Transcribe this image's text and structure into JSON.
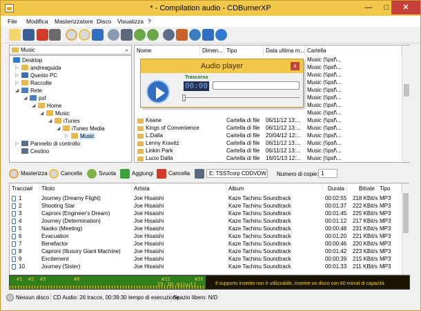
{
  "window": {
    "title": "* - Compilation audio - CDBurnerXP",
    "minimize": "—",
    "maximize": "□",
    "close": "✕"
  },
  "menu": [
    "File",
    "Modifica",
    "Masterizzatore",
    "Disco",
    "Visualizza",
    "?"
  ],
  "toolbar_icons": [
    "new-icon",
    "save-icon",
    "delete-icon",
    "print-icon",
    "burn-icon",
    "burn-disc-icon",
    "stop-icon",
    "disc-info-icon",
    "eject-icon",
    "back-icon",
    "forward-icon",
    "settings-icon",
    "tools-icon",
    "update-icon",
    "help-icon",
    "info-icon"
  ],
  "drive_selector": {
    "value": "Music"
  },
  "tree": [
    {
      "label": "Desktop",
      "icon": "desktop-icon"
    },
    {
      "label": "andreaguida",
      "icon": "folder-icon"
    },
    {
      "label": "Questo PC",
      "icon": "computer-icon"
    },
    {
      "label": "Raccolte",
      "icon": "folder-icon"
    },
    {
      "label": "Rete",
      "icon": "network-icon"
    },
    {
      "label": "psf",
      "icon": "network-icon"
    },
    {
      "label": "Home",
      "icon": "folder-icon"
    },
    {
      "label": "Music",
      "icon": "folder-icon"
    },
    {
      "label": "iTunes",
      "icon": "folder-icon"
    },
    {
      "label": "iTunes Media",
      "icon": "folder-icon"
    },
    {
      "label": "Music",
      "icon": "folder-icon"
    },
    {
      "label": "Pannello di controllo",
      "icon": "control-panel-icon"
    },
    {
      "label": "Cestino",
      "icon": "trash-icon"
    }
  ],
  "files": {
    "columns": [
      "Nome",
      "Dimen...",
      "Tipo",
      "Data ultima m...",
      "Cartella"
    ],
    "rows": [
      {
        "name": "",
        "type": "",
        "date": "",
        "folder": "Music (\\\\psf\\..."
      },
      {
        "name": "",
        "type": "",
        "date": "",
        "folder": "Music (\\\\psf\\..."
      },
      {
        "name": "",
        "type": "",
        "date": "",
        "folder": "Music (\\\\psf\\..."
      },
      {
        "name": "",
        "type": "",
        "date": "",
        "folder": "Music (\\\\psf\\..."
      },
      {
        "name": "",
        "type": "",
        "date": "",
        "folder": "Music (\\\\psf\\..."
      },
      {
        "name": "",
        "type": "",
        "date": "",
        "folder": "Music (\\\\psf\\..."
      },
      {
        "name": "",
        "type": "",
        "date": "",
        "folder": "Music (\\\\psf\\..."
      },
      {
        "name": "",
        "type": "",
        "date": "",
        "folder": "Music (\\\\psf\\..."
      },
      {
        "name": "Keane",
        "type": "Cartella di file",
        "date": "06/11/12 13:...",
        "folder": "Music (\\\\psf\\..."
      },
      {
        "name": "Kings of Convenience",
        "type": "Cartella di file",
        "date": "06/11/12 13:...",
        "folder": "Music (\\\\psf\\..."
      },
      {
        "name": "L.Dalla",
        "type": "Cartella di file",
        "date": "20/04/12 12:...",
        "folder": "Music (\\\\psf\\..."
      },
      {
        "name": "Lenny Kravitz",
        "type": "Cartella di file",
        "date": "06/11/12 13:...",
        "folder": "Music (\\\\psf\\..."
      },
      {
        "name": "Linkin Park",
        "type": "Cartella di file",
        "date": "06/11/12 13:...",
        "folder": "Music (\\\\psf\\..."
      },
      {
        "name": "Lucio Dalla",
        "type": "Cartella di file",
        "date": "16/01/13 12:...",
        "folder": "Music (\\\\psf\\..."
      }
    ]
  },
  "player": {
    "title": "Audio player",
    "elapsed_label": "Trascorso",
    "time": "00:00",
    "close": "x"
  },
  "actions": {
    "masterizza": "Masterizza",
    "cancella1": "Cancella",
    "svuota": "Svuota",
    "aggiungi": "Aggiungi",
    "cancella2": "Cancella",
    "drive": "E: TSSTcorp CDDVDW",
    "copies_label": "Numero di copie:",
    "copies_value": "1"
  },
  "tracks": {
    "columns": [
      "Traccia#",
      "Titolo",
      "Artista",
      "Album",
      "Durata",
      "Bitrate",
      "Tipo"
    ],
    "rows": [
      {
        "n": "1",
        "title": "Journey (Dreamy Flight)",
        "artist": "Joe Hisaishi",
        "album": "Kaze Tachinu Soundtrack",
        "dur": "00:02:55",
        "bitrate": "218 KBit/s",
        "type": "MP3"
      },
      {
        "n": "2",
        "title": "Shooting Star",
        "artist": "Joe Hisaishi",
        "album": "Kaze Tachinu Soundtrack",
        "dur": "00:01:37",
        "bitrate": "222 KBit/s",
        "type": "MP3"
      },
      {
        "n": "3",
        "title": "Caproni (Engineer's Dream)",
        "artist": "Joe Hisaishi",
        "album": "Kaze Tachinu Soundtrack",
        "dur": "00:01:45",
        "bitrate": "225 KBit/s",
        "type": "MP3"
      },
      {
        "n": "4",
        "title": "Journey (Determination)",
        "artist": "Joe Hisaishi",
        "album": "Kaze Tachinu Soundtrack",
        "dur": "00:01:12",
        "bitrate": "217 KBit/s",
        "type": "MP3"
      },
      {
        "n": "5",
        "title": "Naoko (Meeting)",
        "artist": "Joe Hisaishi",
        "album": "Kaze Tachinu Soundtrack",
        "dur": "00:00:48",
        "bitrate": "231 KBit/s",
        "type": "MP3"
      },
      {
        "n": "6",
        "title": "Evacuation",
        "artist": "Joe Hisaishi",
        "album": "Kaze Tachinu Soundtrack",
        "dur": "00:01:20",
        "bitrate": "221 KBit/s",
        "type": "MP3"
      },
      {
        "n": "7",
        "title": "Benefactor",
        "artist": "Joe Hisaishi",
        "album": "Kaze Tachinu Soundtrack",
        "dur": "00:00:46",
        "bitrate": "220 KBit/s",
        "type": "MP3"
      },
      {
        "n": "8",
        "title": "Caproni (Illusory Giant Machine)",
        "artist": "Joe Hisaishi",
        "album": "Kaze Tachinu Soundtrack",
        "dur": "00:01:42",
        "bitrate": "223 KBit/s",
        "type": "MP3"
      },
      {
        "n": "9",
        "title": "Excitement",
        "artist": "Joe Hisaishi",
        "album": "Kaze Tachinu Soundtrack",
        "dur": "00:00:39",
        "bitrate": "215 KBit/s",
        "type": "MP3"
      },
      {
        "n": "10",
        "title": "Journey (Sister)",
        "artist": "Joe Hisaishi",
        "album": "Kaze Tachinu Soundtrack",
        "dur": "00:01:33",
        "bitrate": "211 KBit/s",
        "type": "MP3"
      }
    ]
  },
  "capacity": {
    "markers": [
      "#1",
      "#2",
      "#3",
      "#8",
      "#22",
      "#26"
    ],
    "duration": "39:30 minuti",
    "message": "Il supporto inserito non è utilizzabile, inserire un disco con 80 minuti di capacità",
    "fill_fraction": 0.49
  },
  "status": {
    "disc": "Nessun disco",
    "info": "CD Audio: 26 tracce, 00:39:30 tempo di esecuzione",
    "free": "Spazio libero: N/D"
  },
  "colors": {
    "title_bar": "#f1c84a",
    "close": "#c7403a",
    "capacity_fill": "#2f7d1b",
    "capacity_text": "#d6c640"
  }
}
